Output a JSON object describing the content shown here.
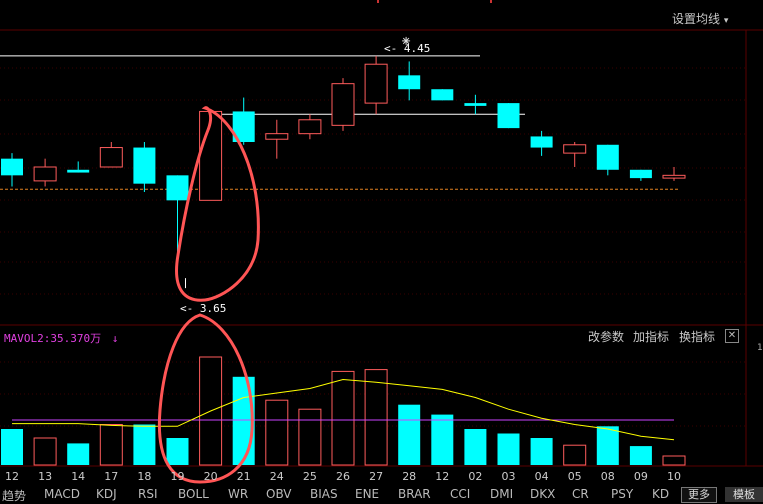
{
  "toolbar": {
    "setting_label": "设置均线",
    "setting_arrow": "▾"
  },
  "price_labels": {
    "high": "4.45",
    "low": "3.65"
  },
  "volume_label": "MAVOL2:35.370万",
  "volume_arrow": "↓",
  "indicator_controls": {
    "change_params": "改参数",
    "add_indicator": "加指标",
    "swap_indicator": "换指标",
    "close": "✕"
  },
  "right_axis_tick": "1",
  "dates": [
    "12",
    "13",
    "14",
    "17",
    "18",
    "19",
    "20",
    "21",
    "24",
    "25",
    "26",
    "27",
    "28",
    "12",
    "02",
    "03",
    "04",
    "05",
    "08",
    "09",
    "10"
  ],
  "tabs": [
    "趋势",
    "MACD",
    "KDJ",
    "RSI",
    "BOLL",
    "WR",
    "OBV",
    "BIAS",
    "ENE",
    "BRAR",
    "CCI",
    "DMI",
    "DKX",
    "CR",
    "PSY",
    "KD"
  ],
  "more_label": "更多",
  "template_label": "模板",
  "colors": {
    "up": "#ff5c5c",
    "down": "#00ffff",
    "ma_yellow": "#ffff00",
    "ma_purple": "#cc44ff",
    "annotation": "#ff5555"
  },
  "chart_data": {
    "type": "candlestick",
    "categories": [
      "12",
      "13",
      "14",
      "17",
      "18",
      "19",
      "20",
      "21",
      "24",
      "25",
      "26",
      "27",
      "28",
      "12",
      "02",
      "03",
      "04",
      "05",
      "08",
      "09",
      "10"
    ],
    "ohlc": [
      {
        "o": 4.08,
        "h": 4.1,
        "l": 3.98,
        "c": 4.02
      },
      {
        "o": 4.0,
        "h": 4.08,
        "l": 3.98,
        "c": 4.05
      },
      {
        "o": 4.04,
        "h": 4.07,
        "l": 4.03,
        "c": 4.03
      },
      {
        "o": 4.05,
        "h": 4.14,
        "l": 4.05,
        "c": 4.12
      },
      {
        "o": 4.12,
        "h": 4.14,
        "l": 3.96,
        "c": 3.99
      },
      {
        "o": 4.02,
        "h": 4.02,
        "l": 3.65,
        "c": 3.93
      },
      {
        "o": 3.93,
        "h": 4.25,
        "l": 3.93,
        "c": 4.25
      },
      {
        "o": 4.25,
        "h": 4.3,
        "l": 4.13,
        "c": 4.14
      },
      {
        "o": 4.15,
        "h": 4.22,
        "l": 4.08,
        "c": 4.17
      },
      {
        "o": 4.17,
        "h": 4.24,
        "l": 4.15,
        "c": 4.22
      },
      {
        "o": 4.2,
        "h": 4.37,
        "l": 4.18,
        "c": 4.35
      },
      {
        "o": 4.28,
        "h": 4.45,
        "l": 4.24,
        "c": 4.42
      },
      {
        "o": 4.38,
        "h": 4.43,
        "l": 4.29,
        "c": 4.33
      },
      {
        "o": 4.33,
        "h": 4.33,
        "l": 4.29,
        "c": 4.29
      },
      {
        "o": 4.28,
        "h": 4.31,
        "l": 4.24,
        "c": 4.27
      },
      {
        "o": 4.28,
        "h": 4.28,
        "l": 4.19,
        "c": 4.19
      },
      {
        "o": 4.16,
        "h": 4.18,
        "l": 4.09,
        "c": 4.12
      },
      {
        "o": 4.1,
        "h": 4.14,
        "l": 4.05,
        "c": 4.13
      },
      {
        "o": 4.13,
        "h": 4.13,
        "l": 4.02,
        "c": 4.04
      },
      {
        "o": 4.04,
        "h": 4.04,
        "l": 4.0,
        "c": 4.01
      },
      {
        "o": 4.01,
        "h": 4.05,
        "l": 4.0,
        "c": 4.02
      }
    ],
    "price_range": [
      3.6,
      4.5
    ],
    "high_marker": {
      "value": 4.45,
      "index": 11
    },
    "low_marker": {
      "value": 3.65,
      "index": 5
    },
    "reference_line": 4.24,
    "dashed_line": 3.97,
    "volume": [
      40,
      30,
      24,
      45,
      45,
      30,
      120,
      98,
      72,
      62,
      104,
      106,
      67,
      56,
      40,
      35,
      30,
      22,
      43,
      21,
      10
    ],
    "volume_range": [
      0,
      150
    ],
    "ma_yellow": [
      46,
      46,
      46,
      44,
      43,
      43,
      60,
      75,
      80,
      85,
      95,
      92,
      88,
      84,
      75,
      62,
      52,
      45,
      40,
      32,
      28
    ],
    "ma_purple": [
      50,
      50,
      50,
      50,
      50,
      50,
      50,
      50,
      50,
      50,
      50,
      50,
      50,
      50,
      50,
      50,
      50,
      50,
      50,
      50,
      50
    ]
  }
}
